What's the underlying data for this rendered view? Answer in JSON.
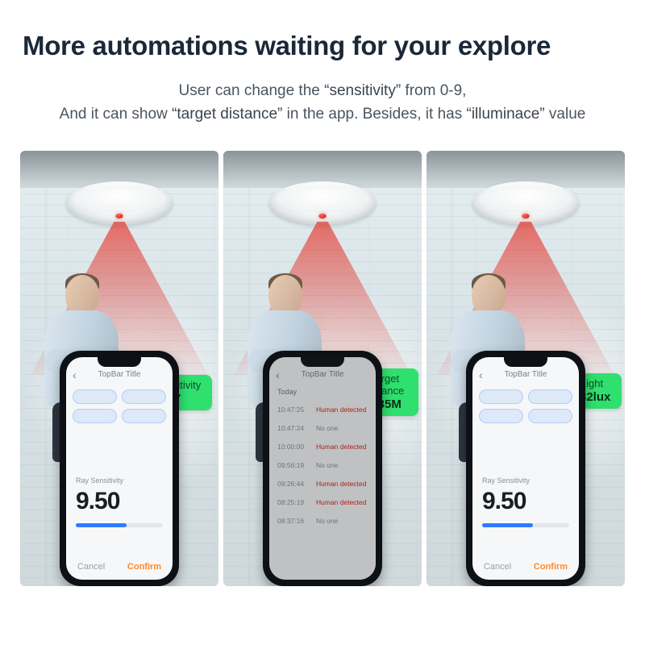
{
  "headline": "More automations waiting for your explore",
  "sub_line1_pre": "User can change the ",
  "sub_line1_q": "“sensitivity”",
  "sub_line1_post": " from 0-9,",
  "sub_line2_pre": "And it can show ",
  "sub_line2_q1": "“target distance”",
  "sub_line2_mid": " in the app. Besides, it has ",
  "sub_line2_q2": "“illuminace”",
  "sub_line2_post": " value",
  "appbar_title": "TopBar Title",
  "chips": {
    "a": {
      "t1": "Sensitivity",
      "t2": "7"
    },
    "b": {
      "t1": "Target distance",
      "t2": "1.35M"
    },
    "c": {
      "t1": "Light",
      "t2": "232lux"
    }
  },
  "slider_screen": {
    "metric_label": "Ray Sensitivity",
    "metric_value": "9.50",
    "cancel": "Cancel",
    "confirm": "Confirm"
  },
  "log_screen": {
    "section": "Today",
    "rows": [
      {
        "ts": "10:47:25",
        "ev": "Human detected",
        "cls": "red"
      },
      {
        "ts": "10:47:24",
        "ev": "No one",
        "cls": "gray"
      },
      {
        "ts": "10:00:00",
        "ev": "Human detected",
        "cls": "red"
      },
      {
        "ts": "09:56:19",
        "ev": "No one",
        "cls": "gray"
      },
      {
        "ts": "09:26:44",
        "ev": "Human detected",
        "cls": "red"
      },
      {
        "ts": "08:25:19",
        "ev": "Human detected",
        "cls": "red"
      },
      {
        "ts": "08:37:16",
        "ev": "No one",
        "cls": "gray"
      }
    ]
  }
}
